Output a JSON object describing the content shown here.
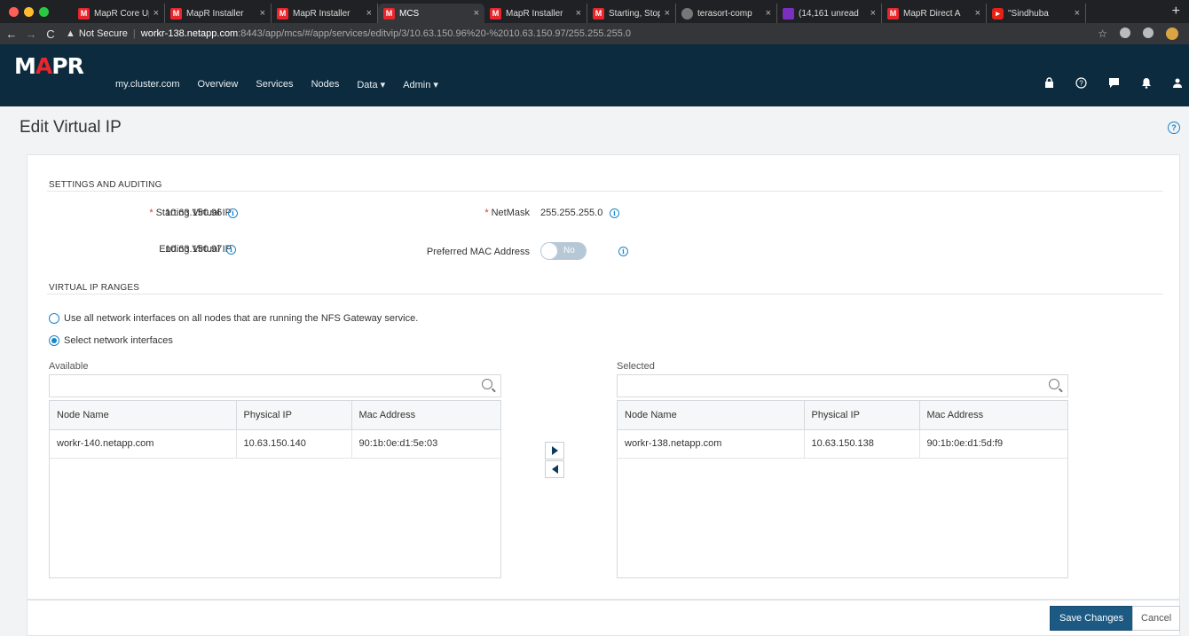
{
  "browser": {
    "tabs": [
      {
        "icon": "mapr-favicon",
        "title": "MapR Core Upg",
        "active": false
      },
      {
        "icon": "mapr-favicon",
        "title": "MapR Installer",
        "active": false
      },
      {
        "icon": "mapr-favicon",
        "title": "MapR Installer",
        "active": false
      },
      {
        "icon": "mapr-favicon",
        "title": "MCS",
        "active": true
      },
      {
        "icon": "mapr-favicon",
        "title": "MapR Installer",
        "active": false
      },
      {
        "icon": "mapr-favicon",
        "title": "Starting, Stopp",
        "active": false
      },
      {
        "icon": "globe-favicon",
        "title": "terasort-comp",
        "active": false
      },
      {
        "icon": "email-favicon",
        "title": "(14,161 unread",
        "active": false
      },
      {
        "icon": "mapr-favicon",
        "title": "MapR Direct A",
        "active": false
      },
      {
        "icon": "youtube-favicon",
        "title": "\"Sindhuba",
        "active": false
      }
    ],
    "address": {
      "security_label": "Not Secure",
      "host": "workr-138.netapp.com",
      "path": ":8443/app/mcs/#/app/services/editvip/3/10.63.150.96%20-%2010.63.150.97/255.255.255.0"
    }
  },
  "app": {
    "logo": "MAPR",
    "cluster_name": "my.cluster.com",
    "nav": [
      "Overview",
      "Services",
      "Nodes",
      "Data ▾",
      "Admin ▾"
    ]
  },
  "page": {
    "title": "Edit Virtual IP"
  },
  "settings": {
    "heading": "SETTINGS AND AUDITING",
    "starting_vip_label": "Starting Virtual IP",
    "starting_vip_value": "10.63.150.96",
    "ending_vip_label": "Ending Virtual IP",
    "ending_vip_value": "10.63.150.97",
    "netmask_label": "NetMask",
    "netmask_value": "255.255.255.0",
    "mac_label": "Preferred MAC Address",
    "mac_toggle": "No"
  },
  "ranges": {
    "heading": "VIRTUAL IP RANGES",
    "option_all": "Use all network interfaces on all nodes that are running the NFS Gateway service.",
    "option_select": "Select network interfaces",
    "selected_option": "select",
    "available_label": "Available",
    "selected_label": "Selected",
    "columns": [
      "Node Name",
      "Physical IP",
      "Mac Address"
    ],
    "available_rows": [
      [
        "workr-140.netapp.com",
        "10.63.150.140",
        "90:1b:0e:d1:5e:03"
      ]
    ],
    "selected_rows": [
      [
        "workr-138.netapp.com",
        "10.63.150.138",
        "90:1b:0e:d1:5d:f9"
      ]
    ]
  },
  "footer": {
    "save_label": "Save Changes",
    "cancel_label": "Cancel"
  },
  "colors": {
    "nav_bg": "#0c2b3f",
    "accent": "#1a85c7",
    "primary_button": "#1c5a83",
    "required": "#d9363e"
  }
}
